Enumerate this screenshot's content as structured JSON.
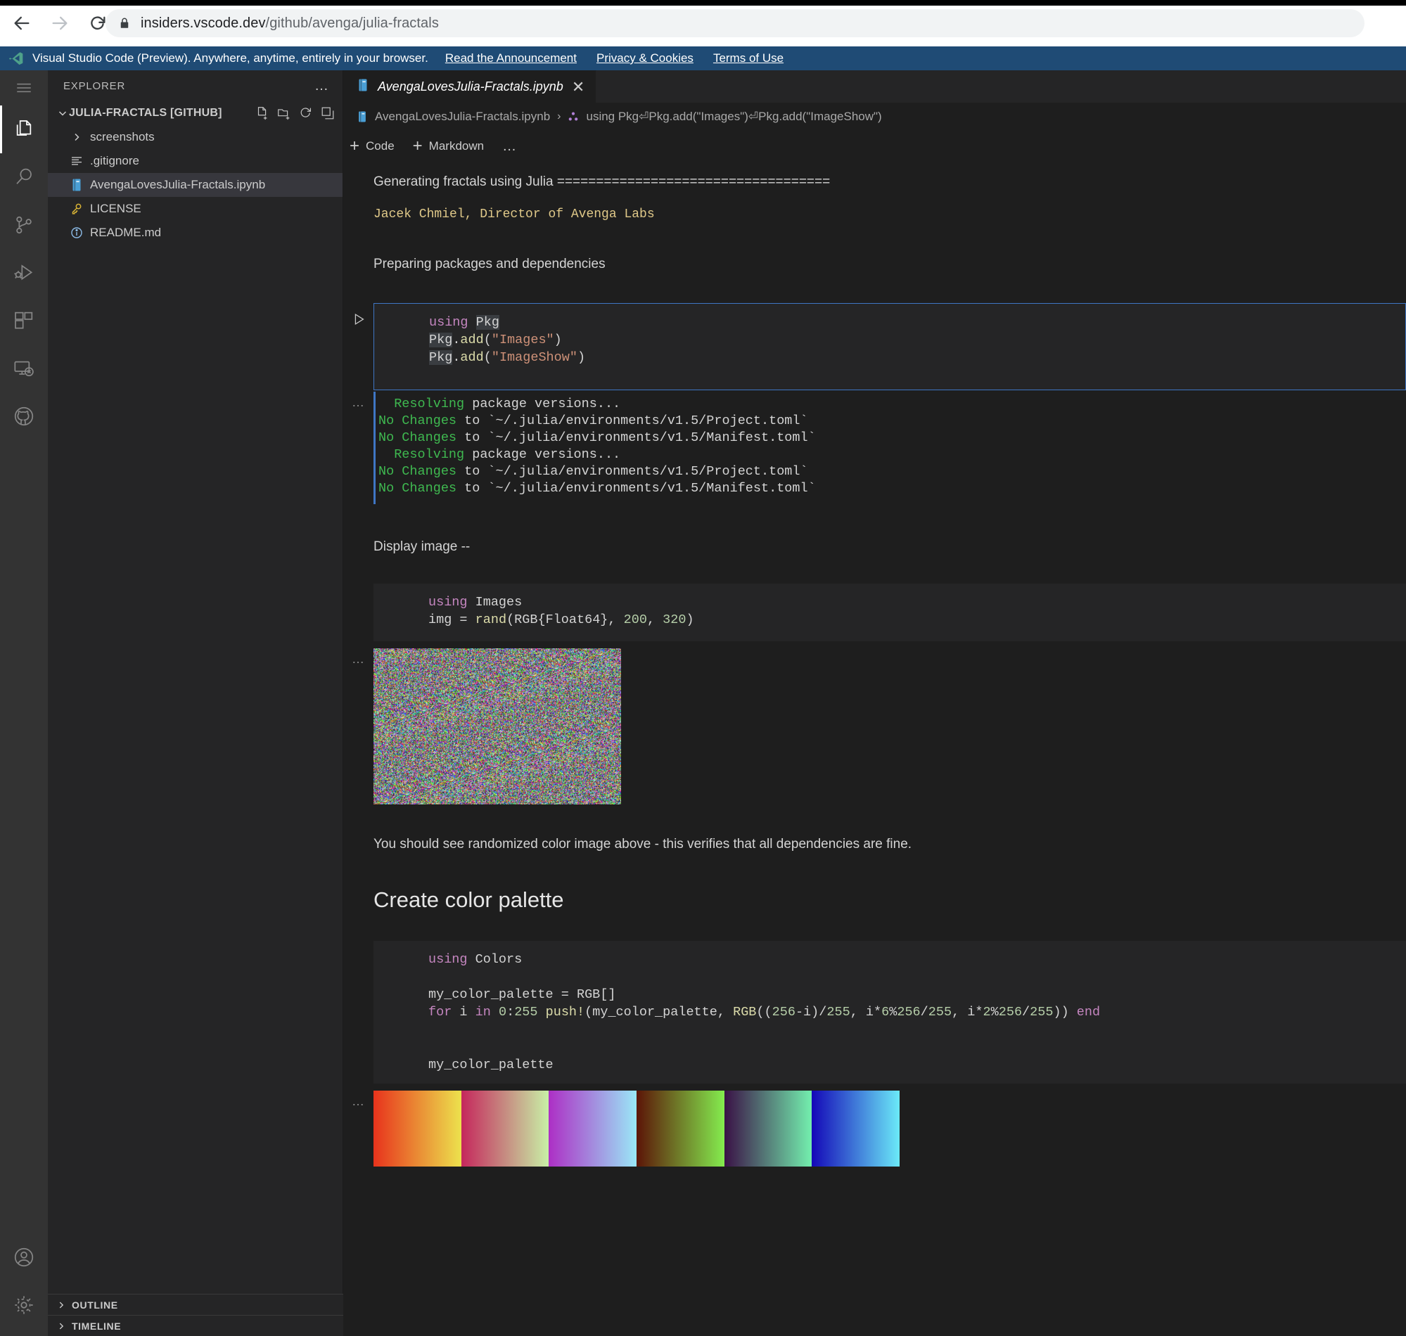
{
  "browser": {
    "back_label": "Back",
    "forward_label": "Forward",
    "reload_label": "Reload",
    "url_host": "insiders.vscode.dev",
    "url_path": "/github/avenga/julia-fractals",
    "url_full": "insiders.vscode.dev/github/avenga/julia-fractals"
  },
  "banner": {
    "text": "Visual Studio Code (Preview). Anywhere, anytime, entirely in your browser.",
    "links": [
      {
        "label": "Read the Announcement"
      },
      {
        "label": "Privacy & Cookies"
      },
      {
        "label": "Terms of Use"
      }
    ],
    "background": "#1f4b75"
  },
  "activity_bar": {
    "items": [
      {
        "name": "menu",
        "label": "Menu"
      },
      {
        "name": "explorer",
        "label": "Explorer",
        "active": true
      },
      {
        "name": "search",
        "label": "Search"
      },
      {
        "name": "source-control",
        "label": "Source Control"
      },
      {
        "name": "run-and-debug",
        "label": "Run and Debug"
      },
      {
        "name": "extensions",
        "label": "Extensions"
      },
      {
        "name": "remote-explorer",
        "label": "Remote Explorer"
      },
      {
        "name": "github",
        "label": "GitHub"
      }
    ],
    "bottom_items": [
      {
        "name": "accounts",
        "label": "Accounts"
      },
      {
        "name": "manage",
        "label": "Manage"
      }
    ]
  },
  "sidebar": {
    "title": "EXPLORER",
    "more_label": "…",
    "root": {
      "label": "JULIA-FRACTALS [GITHUB]",
      "actions": [
        {
          "name": "new-file",
          "label": "New File"
        },
        {
          "name": "new-folder",
          "label": "New Folder"
        },
        {
          "name": "refresh",
          "label": "Refresh Explorer"
        },
        {
          "name": "collapse-all",
          "label": "Collapse Folders in Explorer"
        }
      ]
    },
    "items": [
      {
        "label": "screenshots",
        "type": "folder",
        "selected": false
      },
      {
        "label": ".gitignore",
        "type": "gitignore",
        "selected": false
      },
      {
        "label": "AvengaLovesJulia-Fractals.ipynb",
        "type": "notebook",
        "selected": true
      },
      {
        "label": "LICENSE",
        "type": "license",
        "selected": false
      },
      {
        "label": "README.md",
        "type": "readme",
        "selected": false
      }
    ],
    "sections": [
      {
        "label": "OUTLINE"
      },
      {
        "label": "TIMELINE"
      }
    ]
  },
  "editor": {
    "tab": {
      "label": "AvengaLovesJulia-Fractals.ipynb",
      "close_label": "✕"
    },
    "breadcrumbs": [
      {
        "label": "AvengaLovesJulia-Fractals.ipynb",
        "icon": "notebook-icon"
      },
      {
        "label": "using Pkg⏎Pkg.add(\"Images\")⏎Pkg.add(\"ImageShow\")",
        "icon": "symbol-namespace-icon"
      }
    ],
    "toolbar": {
      "code_label": "Code",
      "markdown_label": "Markdown",
      "more_label": "…"
    }
  },
  "notebook": {
    "cells": [
      {
        "kind": "markdown",
        "name": "cell-title",
        "lines": [
          {
            "text": "Generating fractals using Julia ===================================",
            "style": "p"
          }
        ]
      },
      {
        "kind": "markdown",
        "name": "cell-author",
        "lines": [
          {
            "text": "Jacek Chmiel, Director of Avenga Labs",
            "style": "code-inline"
          }
        ]
      },
      {
        "kind": "markdown",
        "name": "cell-preparing",
        "lines": [
          {
            "text": "Preparing packages and dependencies",
            "style": "p"
          }
        ]
      },
      {
        "kind": "code",
        "name": "cell-code-pkg",
        "focused": true,
        "source": "using Pkg\nPkg.add(\"Images\")\nPkg.add(\"ImageShow\")"
      },
      {
        "kind": "output-stream",
        "name": "output-pkg",
        "collapse_label": "…",
        "lines": [
          "  Resolving package versions...",
          "No Changes to `~/.julia/environments/v1.5/Project.toml`",
          "No Changes to `~/.julia/environments/v1.5/Manifest.toml`",
          "  Resolving package versions...",
          "No Changes to `~/.julia/environments/v1.5/Project.toml`",
          "No Changes to `~/.julia/environments/v1.5/Manifest.toml`"
        ]
      },
      {
        "kind": "markdown",
        "name": "cell-display-image",
        "lines": [
          {
            "text": "Display image --",
            "style": "p"
          }
        ]
      },
      {
        "kind": "code",
        "name": "cell-code-rand-image",
        "focused": false,
        "source": "using Images\nimg = rand(RGB{Float64}, 200, 320)"
      },
      {
        "kind": "output-image",
        "name": "output-random-noise",
        "collapse_label": "…",
        "alt": "randomized color image 200x320"
      },
      {
        "kind": "markdown",
        "name": "cell-verify-text",
        "lines": [
          {
            "text": "You should see randomized color image above - this verifies that all dependencies are fine.",
            "style": "p"
          }
        ]
      },
      {
        "kind": "markdown",
        "name": "cell-heading-palette",
        "lines": [
          {
            "text": "Create color palette",
            "style": "h2"
          }
        ]
      },
      {
        "kind": "code",
        "name": "cell-code-palette",
        "focused": false,
        "source": "using Colors\n\nmy_color_palette = RGB[]\nfor i in 0:255 push!(my_color_palette, RGB((256-i)/255, i*6%256/255, i*2%256/255)) end\n\n\nmy_color_palette"
      },
      {
        "kind": "output-palette",
        "name": "output-color-palette",
        "collapse_label": "…",
        "bands": [
          {
            "from": "#e8331c",
            "to": "#ece24d"
          },
          {
            "from": "#c5275c",
            "to": "#c8f0a6"
          },
          {
            "from": "#ad2fc5",
            "to": "#9ae7f7"
          },
          {
            "from": "#5c1407",
            "to": "#84ec4e"
          },
          {
            "from": "#3a1146",
            "to": "#73efae"
          },
          {
            "from": "#1408b8",
            "to": "#6beaf8"
          }
        ]
      }
    ]
  },
  "theme": {
    "editor_bg": "#1e1e1e",
    "sidebar_bg": "#252526",
    "activity_bg": "#333333",
    "accent_blue": "#3f76c4",
    "keyword": "#c586c0",
    "string": "#ce9178",
    "function": "#dcdcaa",
    "number": "#b5cea8",
    "stream_green": "#3fb950"
  }
}
